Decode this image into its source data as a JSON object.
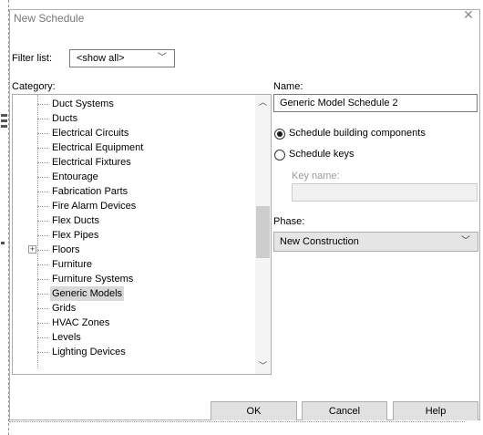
{
  "window": {
    "title": "New Schedule"
  },
  "filter": {
    "label": "Filter list:",
    "value": "<show all>"
  },
  "category": {
    "label": "Category:",
    "items": [
      {
        "label": "Duct Systems"
      },
      {
        "label": "Ducts"
      },
      {
        "label": "Electrical Circuits"
      },
      {
        "label": "Electrical Equipment"
      },
      {
        "label": "Electrical Fixtures"
      },
      {
        "label": "Entourage"
      },
      {
        "label": "Fabrication Parts"
      },
      {
        "label": "Fire Alarm Devices"
      },
      {
        "label": "Flex Ducts"
      },
      {
        "label": "Flex Pipes"
      },
      {
        "label": "Floors",
        "expandable": true
      },
      {
        "label": "Furniture"
      },
      {
        "label": "Furniture Systems"
      },
      {
        "label": "Generic Models",
        "selected": true
      },
      {
        "label": "Grids"
      },
      {
        "label": "HVAC Zones"
      },
      {
        "label": "Levels"
      },
      {
        "label": "Lighting Devices"
      }
    ]
  },
  "name": {
    "label": "Name:",
    "value": "Generic Model Schedule 2"
  },
  "options": {
    "building_components": {
      "label": "Schedule building components",
      "checked": true
    },
    "keys": {
      "label": "Schedule keys",
      "checked": false
    }
  },
  "key_name": {
    "label": "Key name:",
    "value": ""
  },
  "phase": {
    "label": "Phase:",
    "value": "New Construction"
  },
  "buttons": {
    "ok": "OK",
    "cancel": "Cancel",
    "help": "Help"
  },
  "icons": {
    "close": "close-icon",
    "dropdown": "chevron-down-icon",
    "expand": "plus-expander-icon"
  }
}
